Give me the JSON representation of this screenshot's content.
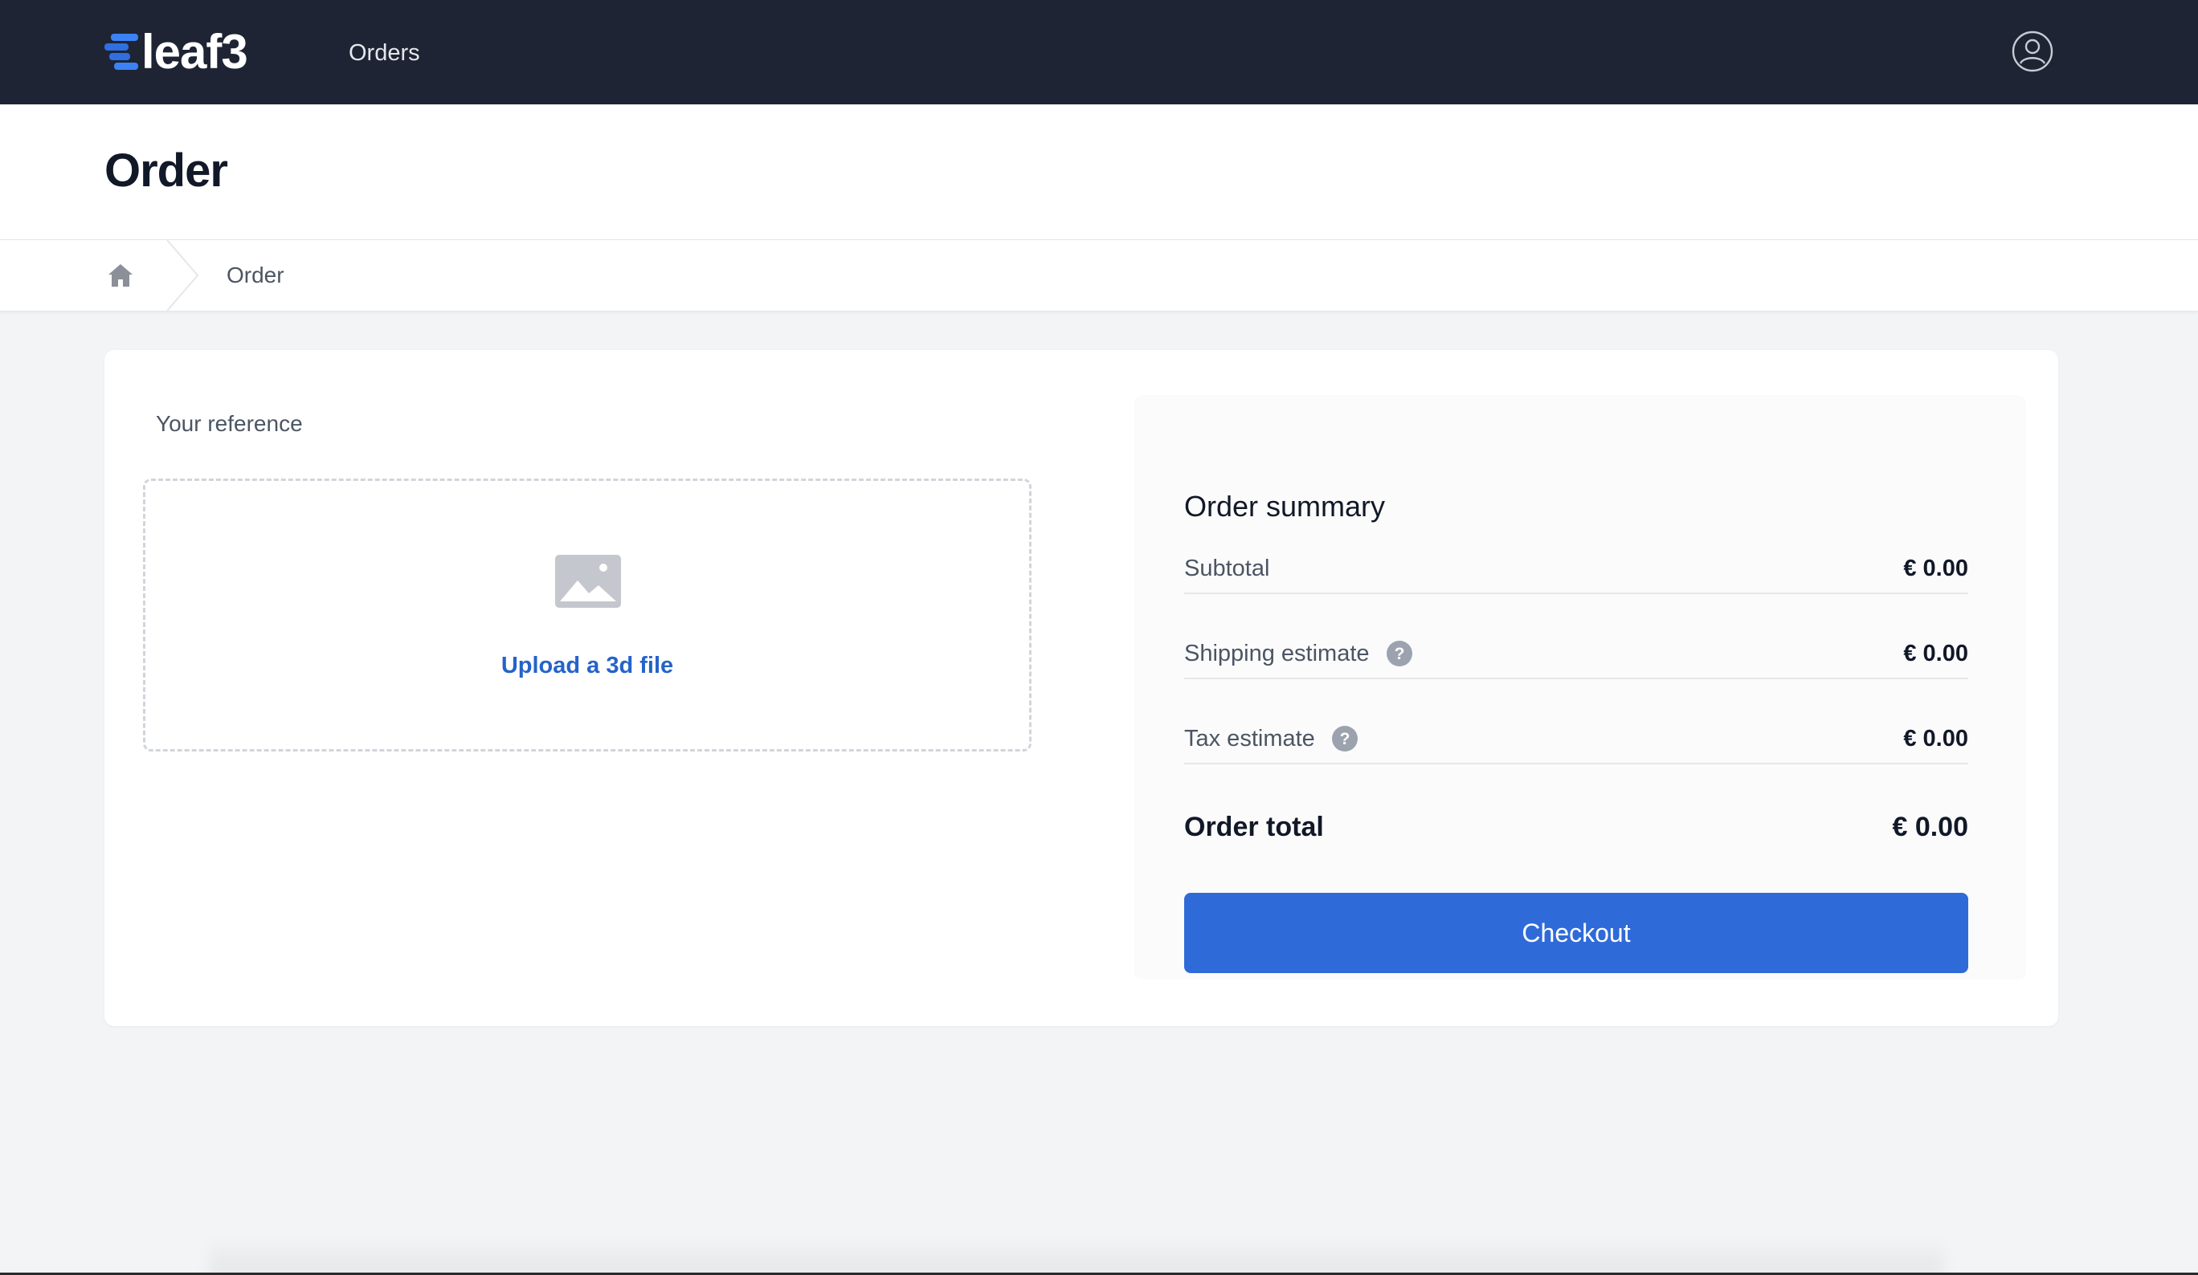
{
  "app": {
    "brand": "leaf3",
    "nav": {
      "orders_label": "Orders"
    }
  },
  "header": {
    "title": "Order"
  },
  "breadcrumb": {
    "items": [
      "Order"
    ]
  },
  "order_form": {
    "reference_label": "Your reference",
    "upload_label": "Upload a 3d file"
  },
  "summary": {
    "title": "Order summary",
    "rows": [
      {
        "label": "Subtotal",
        "value": "€ 0.00"
      },
      {
        "label": "Shipping estimate",
        "value": "€ 0.00"
      },
      {
        "label": "Tax estimate",
        "value": "€ 0.00"
      }
    ],
    "total_label": "Order total",
    "total_value": "€ 0.00",
    "checkout_label": "Checkout"
  },
  "colors": {
    "nav_background": "#1e2433",
    "accent": "#2f6ad9",
    "link": "#2563c9"
  },
  "icons": [
    "logo-mark",
    "user-circle-icon",
    "home-icon",
    "image-icon",
    "question-circle-icon"
  ]
}
